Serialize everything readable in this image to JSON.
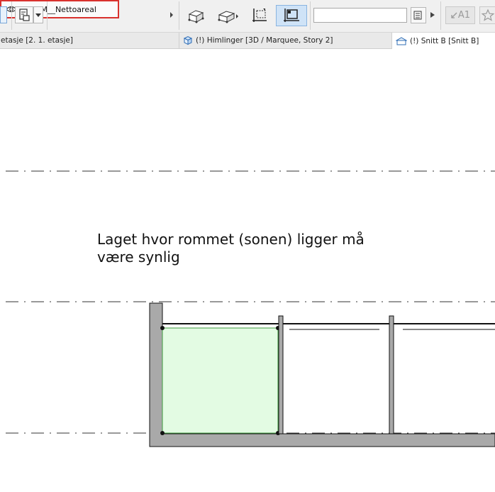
{
  "toolbar": {
    "layer_set_label": "862- M__Nettoareal",
    "search_value": "",
    "layout_label": "A1"
  },
  "tabs": [
    {
      "label": "etasje [2. 1. etasje]"
    },
    {
      "label": "(!) Himlinger [3D / Marquee, Story 2]"
    },
    {
      "label": "(!) Snitt B [Snitt B]"
    }
  ],
  "canvas": {
    "annotation": "Laget hvor rommet (sonen) ligger må\nvære synlig",
    "zone_fill": "#e3fbe3",
    "zone_stroke": "#3f9b3f",
    "wall_fill": "#a9a9a9"
  },
  "colors": {
    "highlight": "#d9322e",
    "active_button": "#cfe3f7"
  }
}
